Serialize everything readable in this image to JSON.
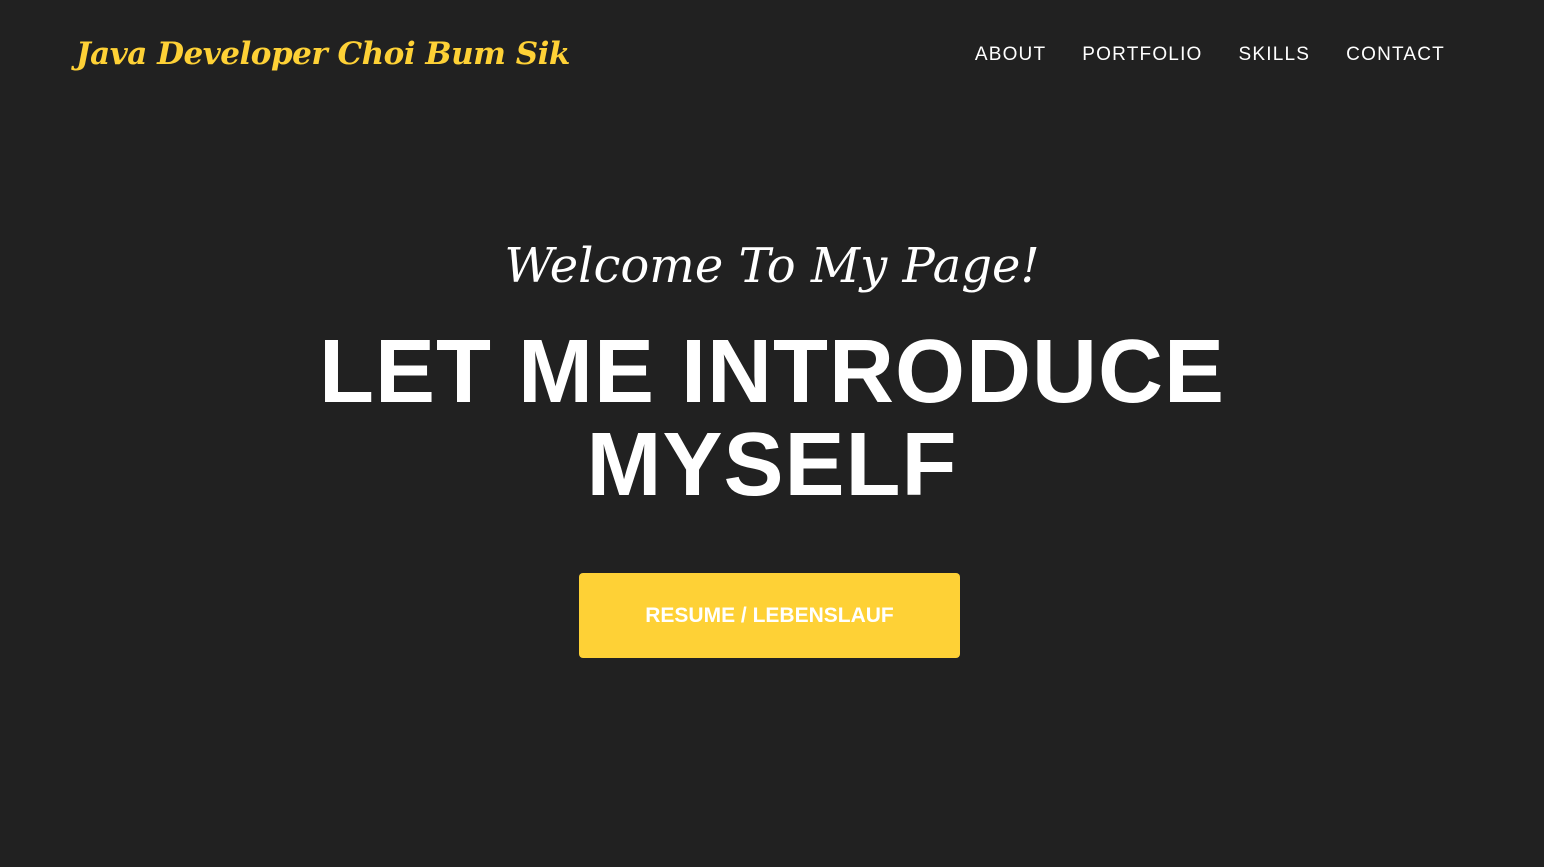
{
  "navbar": {
    "brand": "Java Developer Choi Bum Sik",
    "items": [
      {
        "label": "ABOUT"
      },
      {
        "label": "PORTFOLIO"
      },
      {
        "label": "SKILLS"
      },
      {
        "label": "CONTACT"
      }
    ]
  },
  "hero": {
    "subheading": "Welcome To My Page!",
    "heading": "LET ME INTRODUCE MYSELF",
    "button_label": "RESUME / LEBENSLAUF"
  },
  "colors": {
    "background": "#212121",
    "accent": "#fed136",
    "text": "#ffffff"
  }
}
